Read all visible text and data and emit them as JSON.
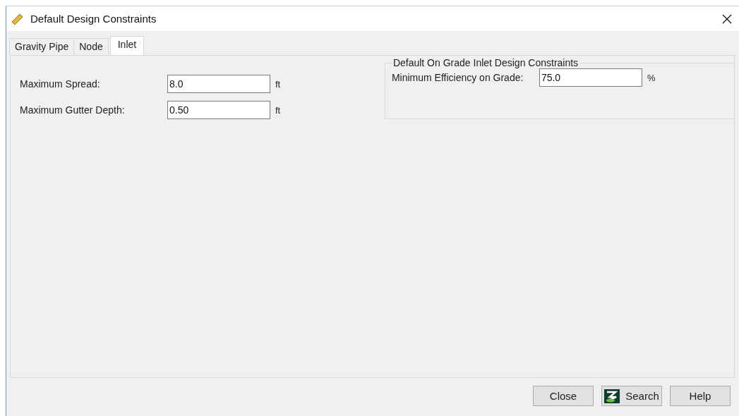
{
  "window": {
    "title": "Default Design Constraints"
  },
  "tabs": [
    {
      "label": "Gravity Pipe",
      "selected": false
    },
    {
      "label": "Node",
      "selected": false
    },
    {
      "label": "Inlet",
      "selected": true
    }
  ],
  "fields": [
    {
      "label": "Maximum Spread:",
      "value": "8.0",
      "unit": "ft"
    },
    {
      "label": "Maximum Gutter Depth:",
      "value": "0.50",
      "unit": "ft"
    }
  ],
  "group": {
    "title": "Default On Grade Inlet Design Constraints",
    "fields": [
      {
        "label": "Minimum Efficiency on Grade:",
        "value": "75.0",
        "unit": "%"
      }
    ]
  },
  "buttons": [
    {
      "label": "Close",
      "kind": "plain"
    },
    {
      "label": "Search",
      "kind": "logo"
    },
    {
      "label": "Help",
      "kind": "plain"
    }
  ]
}
